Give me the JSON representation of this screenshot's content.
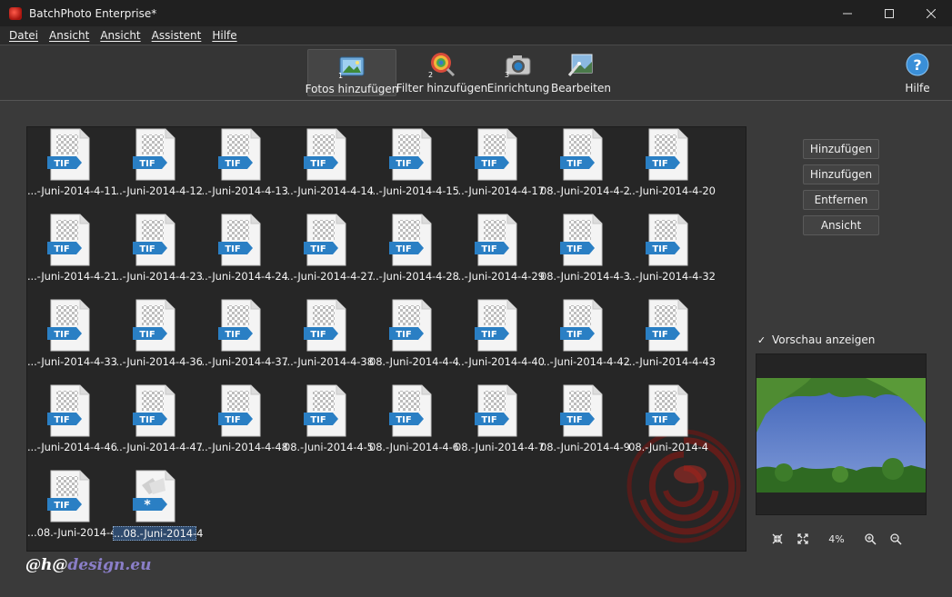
{
  "window": {
    "title": "BatchPhoto Enterprise*",
    "minimize_icon": "minimize-icon",
    "maximize_icon": "maximize-icon",
    "close_icon": "close-icon"
  },
  "menu": [
    "Datei",
    "Ansicht",
    "Ansicht",
    "Assistent",
    "Hilfe"
  ],
  "toolbar": {
    "add_photos": "Fotos hinzufügen",
    "add_filter": "Filter hinzufügen",
    "setup": "Einrichtung",
    "edit": "Bearbeiten",
    "help": "Hilfe"
  },
  "files": [
    "...-Juni-2014-4-11",
    "...-Juni-2014-4-12",
    "...-Juni-2014-4-13",
    "...-Juni-2014-4-14",
    "...-Juni-2014-4-15",
    "...-Juni-2014-4-17",
    "08.-Juni-2014-4-2",
    "...-Juni-2014-4-20",
    "...-Juni-2014-4-21",
    "...-Juni-2014-4-23",
    "...-Juni-2014-4-24",
    "...-Juni-2014-4-27",
    "...-Juni-2014-4-28",
    "...-Juni-2014-4-29",
    "08.-Juni-2014-4-3",
    "...-Juni-2014-4-32",
    "...-Juni-2014-4-33",
    "...-Juni-2014-4-36",
    "...-Juni-2014-4-37",
    "...-Juni-2014-4-38",
    "08.-Juni-2014-4-4",
    "...-Juni-2014-4-40",
    "...-Juni-2014-4-42",
    "...-Juni-2014-4-43",
    "...-Juni-2014-4-46",
    "...-Juni-2014-4-47",
    "...-Juni-2014-4-48",
    "08.-Juni-2014-4-5",
    "08.-Juni-2014-4-6",
    "08.-Juni-2014-4-7",
    "08.-Juni-2014-4-9",
    "08.-Juni-2014-4",
    "...08.-Juni-2014-4",
    "...08.-Juni-2014-4"
  ],
  "file_badge": "TIF",
  "unknown_badge": "*",
  "selected_index": 33,
  "side_buttons": [
    "Hinzufügen",
    "Hinzufügen",
    "Entfernen",
    "Ansicht"
  ],
  "preview": {
    "checkbox_label": "Vorschau anzeigen",
    "checked": true
  },
  "zoom": {
    "level": "4%"
  },
  "signature": {
    "prefix": "@h@",
    "suffix": "design.eu"
  },
  "colors": {
    "accent_blue": "#2a7fc4",
    "watermark_red": "#a8140e"
  }
}
